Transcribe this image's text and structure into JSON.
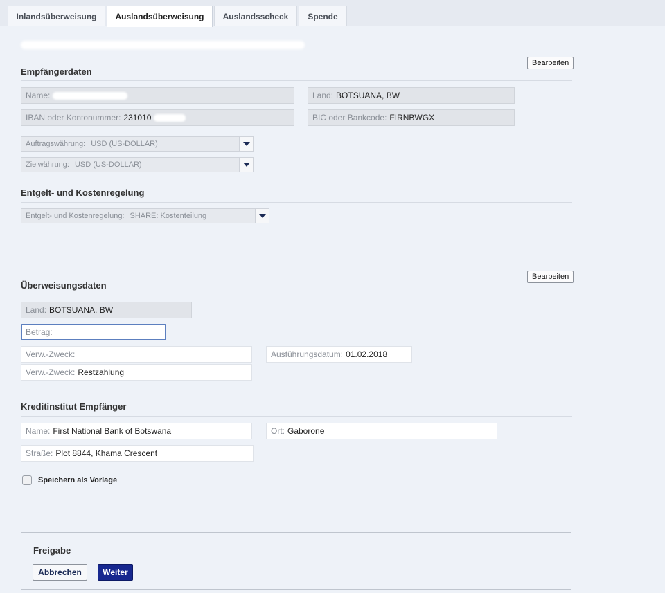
{
  "tabs": [
    {
      "label": "Inlandsüberweisung"
    },
    {
      "label": "Auslandsüberweisung"
    },
    {
      "label": "Auslandsscheck"
    },
    {
      "label": "Spende"
    }
  ],
  "recipient": {
    "title": "Empfängerdaten",
    "edit_label": "Bearbeiten",
    "name_label": "Name:",
    "country_label": "Land:",
    "country_value": "BOTSUANA, BW",
    "iban_label": "IBAN oder Kontonummer:",
    "iban_value": "231010",
    "bic_label": "BIC oder Bankcode:",
    "bic_value": "FIRNBWGX",
    "order_currency_label": "Auftragswährung:",
    "order_currency_value": "USD (US-DOLLAR)",
    "target_currency_label": "Zielwährung:",
    "target_currency_value": "USD (US-DOLLAR)"
  },
  "fees": {
    "title": "Entgelt- und Kostenregelung",
    "select_label": "Entgelt- und Kostenregelung:",
    "select_value": "SHARE: Kostenteilung"
  },
  "transfer": {
    "title": "Überweisungsdaten",
    "edit_label": "Bearbeiten",
    "country_label": "Land:",
    "country_value": "BOTSUANA, BW",
    "amount_label": "Betrag:",
    "purpose1_label": "Verw.-Zweck:",
    "purpose1_value": "",
    "purpose2_label": "Verw.-Zweck:",
    "purpose2_value": "Restzahlung",
    "exec_date_label": "Ausführungsdatum:",
    "exec_date_value": "01.02.2018"
  },
  "bank": {
    "title": "Kreditinstitut Empfänger",
    "name_label": "Name:",
    "name_value": "First National Bank of Botswana",
    "city_label": "Ort:",
    "city_value": "Gaborone",
    "street_label": "Straße:",
    "street_value": "Plot 8844, Khama Crescent"
  },
  "save_template_label": "Speichern als Vorlage",
  "release": {
    "title": "Freigabe",
    "cancel_label": "Abbrechen",
    "next_label": "Weiter"
  }
}
